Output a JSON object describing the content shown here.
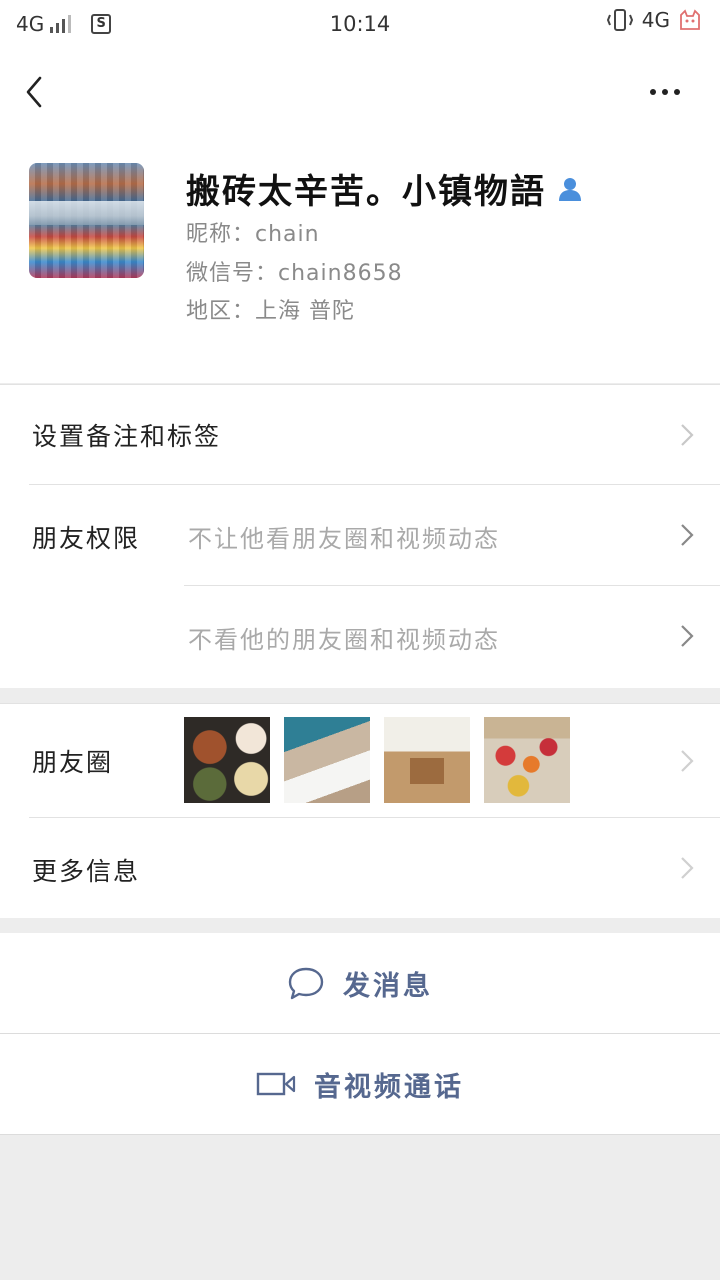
{
  "status_bar": {
    "network_left": "4G",
    "sim_label": "S",
    "time": "10:14",
    "network_right": "4G"
  },
  "profile": {
    "name": "搬砖太辛苦。小镇物語",
    "nickname": "昵称：chain",
    "wechat_id": "微信号：chain8658",
    "region": "地区：上海  普陀"
  },
  "menu": {
    "remark_label": "设置备注和标签",
    "permissions_label": "朋友权限",
    "permission_1": "不让他看朋友圈和视频动态",
    "permission_2": "不看他的朋友圈和视频动态",
    "moments_label": "朋友圈",
    "more_info_label": "更多信息"
  },
  "actions": {
    "message_label": "发消息",
    "call_label": "音视频通话"
  },
  "colors": {
    "accent_text": "#56688f",
    "icon_blue": "#4a8fdc"
  }
}
